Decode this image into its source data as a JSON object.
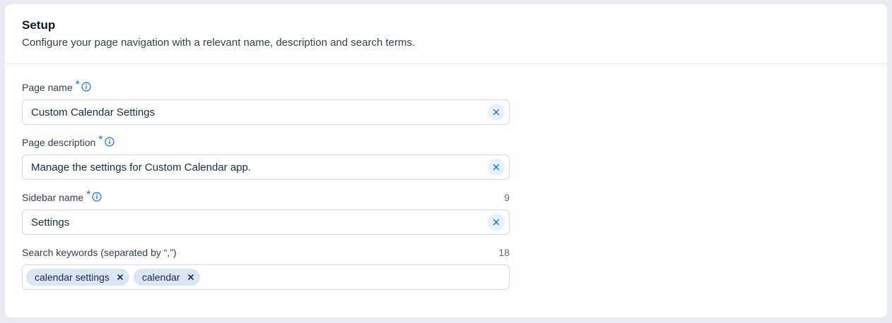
{
  "section": {
    "title": "Setup",
    "subtitle": "Configure your page navigation with a relevant name, description and search terms."
  },
  "fields": {
    "page_name": {
      "label": "Page name",
      "required_mark": "*",
      "value": "Custom Calendar Settings"
    },
    "page_description": {
      "label": "Page description",
      "required_mark": "*",
      "value": "Manage the settings for Custom Calendar app."
    },
    "sidebar_name": {
      "label": "Sidebar name",
      "required_mark": "*",
      "value": "Settings",
      "counter": "9"
    },
    "search_keywords": {
      "label": "Search keywords (separated by “,”)",
      "counter": "18",
      "tags": [
        "calendar settings",
        "calendar"
      ],
      "remove_glyph": "×"
    }
  },
  "icons": {
    "info": "info-icon",
    "clear": "close-icon"
  },
  "colors": {
    "accent": "#116dff",
    "input_border": "#c9dcf2",
    "tag_bg": "#d9e6f8",
    "page_bg": "#e8ecf2"
  }
}
